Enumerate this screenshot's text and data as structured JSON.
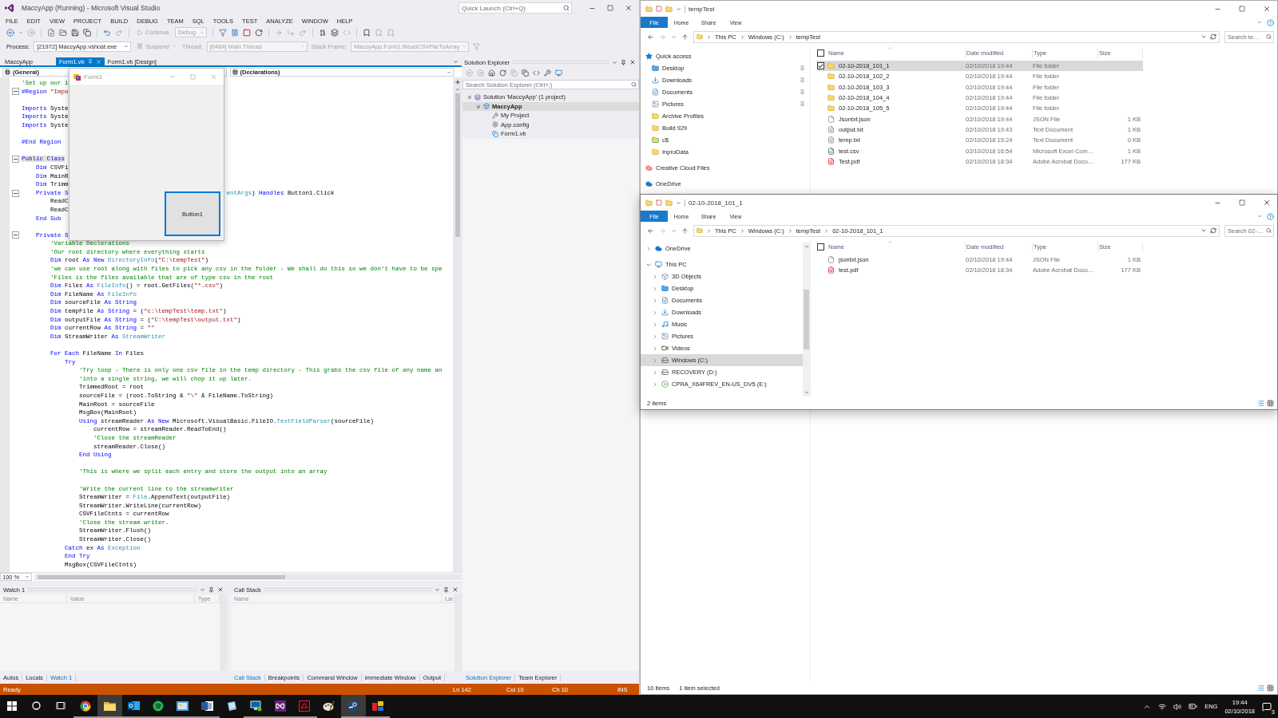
{
  "vs": {
    "title": "MaccyApp (Running) - Microsoft Visual Studio",
    "quick_launch": {
      "placeholder": "Quick Launch (Ctrl+Q)"
    },
    "menu": [
      "FILE",
      "EDIT",
      "VIEW",
      "PROJECT",
      "BUILD",
      "DEBUG",
      "TEAM",
      "SQL",
      "TOOLS",
      "TEST",
      "ANALYZE",
      "WINDOW",
      "HELP"
    ],
    "debug_toolbar": [
      {
        "kind": "button",
        "text": "Continue",
        "disabled": true
      },
      {
        "kind": "dropdown",
        "text": "Debug",
        "disabled": true
      }
    ],
    "process_toolbar": [
      {
        "kind": "label",
        "text": "Process:",
        "disabled": false
      },
      {
        "kind": "dropdown",
        "text": "[21972] MaccyApp.vshost.exe",
        "disabled": false
      },
      {
        "kind": "button",
        "text": "Suspend",
        "disabled": true
      },
      {
        "kind": "label",
        "text": "Thread:",
        "disabled": true
      },
      {
        "kind": "dropdown",
        "text": "[6484] Main Thread",
        "disabled": true
      },
      {
        "kind": "label",
        "text": "Stack Frame:",
        "disabled": true
      },
      {
        "kind": "dropdown",
        "text": "MaccyApp.Form1.ReadCSVFileToArray",
        "disabled": true
      }
    ],
    "project": "MaccyApp",
    "document_tabs": [
      {
        "label": "Form1.vb",
        "selected": true
      },
      {
        "label": "Form1.vb [Design]",
        "selected": false
      }
    ],
    "navigation": {
      "types": "(General)",
      "members": "(Declarations)"
    },
    "code": [
      {
        "kind": "code",
        "fold": false,
        "tokens": [
          {
            "kind": "comment",
            "text": "'Set up our i"
          }
        ]
      },
      {
        "kind": "code",
        "fold": true,
        "tokens": [
          {
            "kind": "keyword",
            "text": "#Region"
          },
          {
            "kind": "string",
            "text": " \"Impo"
          }
        ]
      },
      {
        "kind": "blank"
      },
      {
        "kind": "code",
        "fold": false,
        "tokens": [
          {
            "kind": "keyword",
            "text": "Imports"
          },
          {
            "kind": "plain",
            "text": " Syste"
          }
        ]
      },
      {
        "kind": "code",
        "fold": false,
        "tokens": [
          {
            "kind": "keyword",
            "text": "Imports"
          },
          {
            "kind": "plain",
            "text": " Syste"
          }
        ]
      },
      {
        "kind": "code",
        "fold": false,
        "tokens": [
          {
            "kind": "keyword",
            "text": "Imports"
          },
          {
            "kind": "plain",
            "text": " Syste"
          }
        ]
      },
      {
        "kind": "blank"
      },
      {
        "kind": "code",
        "fold": false,
        "tokens": [
          {
            "kind": "keyword",
            "text": "#End Region"
          }
        ]
      },
      {
        "kind": "blank"
      },
      {
        "kind": "code",
        "fold": true,
        "tokens": [
          {
            "kind": "match",
            "text": "Public Class"
          }
        ]
      },
      {
        "kind": "code",
        "fold": false,
        "tokens": [
          {
            "kind": "keyword",
            "text": "    Dim"
          },
          {
            "kind": "plain",
            "text": " CSVFi"
          }
        ]
      },
      {
        "kind": "code",
        "fold": false,
        "tokens": [
          {
            "kind": "keyword",
            "text": "    Dim"
          },
          {
            "kind": "plain",
            "text": " MainR"
          }
        ]
      },
      {
        "kind": "code",
        "fold": false,
        "tokens": [
          {
            "kind": "keyword",
            "text": "    Dim"
          },
          {
            "kind": "plain",
            "text": " Trimm"
          }
        ]
      },
      {
        "kind": "code",
        "fold": true,
        "tokens": [
          {
            "kind": "keyword",
            "text": "    Private S"
          }
        ],
        "tail": [
          {
            "kind": "type",
            "text": "entArgs"
          },
          {
            "kind": "plain",
            "text": ") "
          },
          {
            "kind": "keyword",
            "text": "Handles"
          },
          {
            "kind": "plain",
            "text": " Button1.Click"
          }
        ]
      },
      {
        "kind": "code",
        "fold": false,
        "tokens": [
          {
            "kind": "plain",
            "text": "        ReadC"
          }
        ]
      },
      {
        "kind": "code",
        "fold": false,
        "tokens": [
          {
            "kind": "plain",
            "text": "        ReadC"
          }
        ]
      },
      {
        "kind": "code",
        "fold": false,
        "tokens": [
          {
            "kind": "keyword",
            "text": "    End Sub"
          }
        ]
      },
      {
        "kind": "blank"
      },
      {
        "kind": "code",
        "fold": true,
        "tokens": [
          {
            "kind": "keyword",
            "text": "    Private S"
          }
        ]
      },
      {
        "kind": "code",
        "fold": false,
        "tokens": [
          {
            "kind": "comment",
            "text": "        'Variable Declerations"
          }
        ]
      },
      {
        "kind": "code",
        "fold": false,
        "tokens": [
          {
            "kind": "comment",
            "text": "        'Our root directory where everything starts"
          }
        ]
      },
      {
        "kind": "code",
        "fold": false,
        "tokens": [
          {
            "kind": "keyword",
            "text": "        Dim"
          },
          {
            "kind": "plain",
            "text": " root "
          },
          {
            "kind": "keyword",
            "text": "As New "
          },
          {
            "kind": "type",
            "text": "DirectoryInfo"
          },
          {
            "kind": "plain",
            "text": "("
          },
          {
            "kind": "string",
            "text": "\"C:\\tempTest\""
          },
          {
            "kind": "plain",
            "text": ")"
          }
        ]
      },
      {
        "kind": "code",
        "fold": false,
        "tokens": [
          {
            "kind": "comment",
            "text": "        'we can use root along with files to pick any csv in the folder - We shall do this so we don't have to be spe"
          }
        ]
      },
      {
        "kind": "code",
        "fold": false,
        "tokens": [
          {
            "kind": "comment",
            "text": "        'Files is the files available that are of type csv in the root"
          }
        ]
      },
      {
        "kind": "code",
        "fold": false,
        "tokens": [
          {
            "kind": "keyword",
            "text": "        Dim"
          },
          {
            "kind": "plain",
            "text": " Files "
          },
          {
            "kind": "keyword",
            "text": "As "
          },
          {
            "kind": "type",
            "text": "FileInfo"
          },
          {
            "kind": "plain",
            "text": "() = root.GetFiles("
          },
          {
            "kind": "string",
            "text": "\"*.csv\""
          },
          {
            "kind": "plain",
            "text": ")"
          }
        ]
      },
      {
        "kind": "code",
        "fold": false,
        "tokens": [
          {
            "kind": "keyword",
            "text": "        Dim"
          },
          {
            "kind": "plain",
            "text": " FileName "
          },
          {
            "kind": "keyword",
            "text": "As "
          },
          {
            "kind": "type",
            "text": "FileInfo"
          }
        ]
      },
      {
        "kind": "code",
        "fold": false,
        "tokens": [
          {
            "kind": "keyword",
            "text": "        Dim"
          },
          {
            "kind": "plain",
            "text": " sourceFile "
          },
          {
            "kind": "keyword",
            "text": "As String"
          }
        ]
      },
      {
        "kind": "code",
        "fold": false,
        "tokens": [
          {
            "kind": "keyword",
            "text": "        Dim"
          },
          {
            "kind": "plain",
            "text": " tempFile "
          },
          {
            "kind": "keyword",
            "text": "As String"
          },
          {
            "kind": "plain",
            "text": " = ("
          },
          {
            "kind": "string",
            "text": "\"c:\\tempTest\\temp.txt\""
          },
          {
            "kind": "plain",
            "text": ")"
          }
        ]
      },
      {
        "kind": "code",
        "fold": false,
        "tokens": [
          {
            "kind": "keyword",
            "text": "        Dim"
          },
          {
            "kind": "plain",
            "text": " outputFile "
          },
          {
            "kind": "keyword",
            "text": "As String"
          },
          {
            "kind": "plain",
            "text": " = ("
          },
          {
            "kind": "string",
            "text": "\"C:\\tempTest\\output.txt\""
          },
          {
            "kind": "plain",
            "text": ")"
          }
        ]
      },
      {
        "kind": "code",
        "fold": false,
        "tokens": [
          {
            "kind": "keyword",
            "text": "        Dim"
          },
          {
            "kind": "plain",
            "text": " currentRow "
          },
          {
            "kind": "keyword",
            "text": "As String"
          },
          {
            "kind": "plain",
            "text": " = "
          },
          {
            "kind": "string",
            "text": "\"\""
          }
        ]
      },
      {
        "kind": "code",
        "fold": false,
        "tokens": [
          {
            "kind": "keyword",
            "text": "        Dim"
          },
          {
            "kind": "plain",
            "text": " StreamWriter "
          },
          {
            "kind": "keyword",
            "text": "As "
          },
          {
            "kind": "type",
            "text": "StreamWriter"
          }
        ]
      },
      {
        "kind": "blank"
      },
      {
        "kind": "code",
        "fold": false,
        "tokens": [
          {
            "kind": "keyword",
            "text": "        For Each"
          },
          {
            "kind": "plain",
            "text": " FileName "
          },
          {
            "kind": "keyword",
            "text": "In"
          },
          {
            "kind": "plain",
            "text": " Files"
          }
        ]
      },
      {
        "kind": "code",
        "fold": false,
        "tokens": [
          {
            "kind": "keyword",
            "text": "            Try"
          }
        ]
      },
      {
        "kind": "code",
        "fold": false,
        "tokens": [
          {
            "kind": "comment",
            "text": "                'Try loop - There is only one csv file in the temp directory - This grabs the csv file of any name an"
          }
        ]
      },
      {
        "kind": "code",
        "fold": false,
        "tokens": [
          {
            "kind": "comment",
            "text": "                'into a single string, we will chop it up later."
          }
        ]
      },
      {
        "kind": "code",
        "fold": false,
        "tokens": [
          {
            "kind": "plain",
            "text": "                TrimmedRoot = root"
          }
        ]
      },
      {
        "kind": "code",
        "fold": false,
        "tokens": [
          {
            "kind": "plain",
            "text": "                sourceFile = (root.ToString & "
          },
          {
            "kind": "string",
            "text": "\"\\\""
          },
          {
            "kind": "plain",
            "text": " & FileName.ToString)"
          }
        ]
      },
      {
        "kind": "code",
        "fold": false,
        "tokens": [
          {
            "kind": "plain",
            "text": "                MainRoot = sourceFile"
          }
        ]
      },
      {
        "kind": "code",
        "fold": false,
        "tokens": [
          {
            "kind": "plain",
            "text": "                MsgBox(MainRoot)"
          }
        ]
      },
      {
        "kind": "code",
        "fold": false,
        "tokens": [
          {
            "kind": "keyword",
            "text": "                Using"
          },
          {
            "kind": "plain",
            "text": " streamReader "
          },
          {
            "kind": "keyword",
            "text": "As New"
          },
          {
            "kind": "plain",
            "text": " Microsoft.VisualBasic.FileIO."
          },
          {
            "kind": "type",
            "text": "TextFieldParser"
          },
          {
            "kind": "plain",
            "text": "(sourceFile)"
          }
        ]
      },
      {
        "kind": "code",
        "fold": false,
        "tokens": [
          {
            "kind": "plain",
            "text": "                    currentRow = streamReader.ReadToEnd()"
          }
        ]
      },
      {
        "kind": "code",
        "fold": false,
        "tokens": [
          {
            "kind": "comment",
            "text": "                    'Close the streamReader"
          }
        ]
      },
      {
        "kind": "code",
        "fold": false,
        "tokens": [
          {
            "kind": "plain",
            "text": "                    streamReader.Close()"
          }
        ]
      },
      {
        "kind": "code",
        "fold": false,
        "tokens": [
          {
            "kind": "keyword",
            "text": "                End Using"
          }
        ]
      },
      {
        "kind": "blank"
      },
      {
        "kind": "code",
        "fold": false,
        "tokens": [
          {
            "kind": "comment",
            "text": "                'This is where we split each entry and store the output into an array"
          }
        ]
      },
      {
        "kind": "blank"
      },
      {
        "kind": "code",
        "fold": false,
        "tokens": [
          {
            "kind": "comment",
            "text": "                'Write the current line to the streamwriter"
          }
        ]
      },
      {
        "kind": "code",
        "fold": false,
        "tokens": [
          {
            "kind": "plain",
            "text": "                StreamWriter = "
          },
          {
            "kind": "type",
            "text": "File"
          },
          {
            "kind": "plain",
            "text": ".AppendText(outputFile)"
          }
        ]
      },
      {
        "kind": "code",
        "fold": false,
        "tokens": [
          {
            "kind": "plain",
            "text": "                StreamWriter.WriteLine(currentRow)"
          }
        ]
      },
      {
        "kind": "code",
        "fold": false,
        "tokens": [
          {
            "kind": "plain",
            "text": "                CSVFileCtnts = currentRow"
          }
        ]
      },
      {
        "kind": "code",
        "fold": false,
        "tokens": [
          {
            "kind": "comment",
            "text": "                'Close the stream writer."
          }
        ]
      },
      {
        "kind": "code",
        "fold": false,
        "tokens": [
          {
            "kind": "plain",
            "text": "                StreamWriter.Flush()"
          }
        ]
      },
      {
        "kind": "code",
        "fold": false,
        "tokens": [
          {
            "kind": "plain",
            "text": "                StreamWriter.Close()"
          }
        ]
      },
      {
        "kind": "code",
        "fold": false,
        "tokens": [
          {
            "kind": "keyword",
            "text": "            Catch"
          },
          {
            "kind": "plain",
            "text": " ex "
          },
          {
            "kind": "keyword",
            "text": "As "
          },
          {
            "kind": "type",
            "text": "Exception"
          }
        ]
      },
      {
        "kind": "code",
        "fold": false,
        "tokens": [
          {
            "kind": "keyword",
            "text": "            End Try"
          }
        ]
      },
      {
        "kind": "code",
        "fold": false,
        "tokens": [
          {
            "kind": "plain",
            "text": "            MsgBox(CSVFileCtnts)"
          }
        ]
      }
    ],
    "zoom": "100 %",
    "watch": {
      "title": "Watch 1",
      "columns": [
        "Name",
        "Value",
        "Type"
      ]
    },
    "call_stack": {
      "title": "Call Stack",
      "columns": [
        "Name",
        "Lar"
      ]
    },
    "watch_tabs": [
      {
        "label": "Autos",
        "selected": false
      },
      {
        "label": "Locals",
        "selected": false
      },
      {
        "label": "Watch 1",
        "selected": true
      }
    ],
    "debug_tabs": [
      {
        "label": "Call Stack",
        "selected": true
      },
      {
        "label": "Breakpoints",
        "selected": false
      },
      {
        "label": "Command Window",
        "selected": false
      },
      {
        "label": "Immediate Window",
        "selected": false
      },
      {
        "label": "Output",
        "selected": false
      }
    ],
    "solution_explorer": {
      "title": "Solution Explorer",
      "search": {
        "placeholder": "Search Solution Explorer (Ctrl+;)"
      },
      "tree": [
        {
          "label": "Solution 'MaccyApp' (1 project)",
          "kind": "solution",
          "selected": false,
          "children": [
            {
              "label": "MaccyApp",
              "kind": "project",
              "selected": true,
              "children": [
                {
                  "label": "My Project",
                  "kind": "wrench",
                  "selected": false
                },
                {
                  "label": "App.config",
                  "kind": "config",
                  "selected": false
                },
                {
                  "label": "Form1.vb",
                  "kind": "form",
                  "selected": false
                }
              ]
            }
          ]
        }
      ],
      "tabs": [
        {
          "label": "Solution Explorer",
          "selected": true
        },
        {
          "label": "Team Explorer",
          "selected": false
        }
      ]
    },
    "status_bar": {
      "message": "Ready",
      "line": "Ln 142",
      "column": "Col 10",
      "char": "Ch 10",
      "mode": "INS"
    }
  },
  "form1": {
    "title": "Form1",
    "button": "Button1"
  },
  "explorers": [
    {
      "title": "tempTest",
      "ribbon_tabs": [
        {
          "label": "File",
          "kind": "file"
        },
        {
          "label": "Home",
          "kind": "tab"
        },
        {
          "label": "Share",
          "kind": "tab"
        },
        {
          "label": "View",
          "kind": "tab"
        }
      ],
      "path": [
        "This PC",
        "Windows (C:)",
        "tempTest"
      ],
      "search": {
        "placeholder": "Search te…"
      },
      "nav": [
        {
          "label": "Quick access",
          "kind": "star",
          "selected": false,
          "children": [
            {
              "label": "Desktop",
              "kind": "desktop",
              "pinned": true,
              "selected": false
            },
            {
              "label": "Downloads",
              "kind": "download",
              "pinned": true,
              "selected": false
            },
            {
              "label": "Documents",
              "kind": "documents",
              "pinned": true,
              "selected": false
            },
            {
              "label": "Pictures",
              "kind": "pictures",
              "pinned": true,
              "selected": false
            },
            {
              "label": "Archive Profiles",
              "kind": "folder",
              "pinned": false,
              "selected": false
            },
            {
              "label": "Build 929",
              "kind": "folder",
              "pinned": false,
              "selected": false
            },
            {
              "label": "c$",
              "kind": "share",
              "pinned": false,
              "selected": false
            },
            {
              "label": "InproData",
              "kind": "folder",
              "pinned": false,
              "selected": false
            }
          ]
        },
        {
          "label": "Creative Cloud Files",
          "kind": "creative",
          "selected": false
        },
        {
          "label": "OneDrive",
          "kind": "cloud",
          "selected": false
        }
      ],
      "all_selected": false,
      "columns": [
        "Name",
        "Date modified",
        "Type",
        "Size"
      ],
      "files": [
        {
          "name": "02-10-2018_101_1",
          "modified": "02/10/2018 19:44",
          "type": "File folder",
          "kind": "folder",
          "selected": true
        },
        {
          "name": "02-10-2018_102_2",
          "modified": "02/10/2018 19:44",
          "type": "File folder",
          "kind": "folder",
          "selected": false
        },
        {
          "name": "02-10-2018_103_3",
          "modified": "02/10/2018 19:44",
          "type": "File folder",
          "kind": "folder",
          "selected": false
        },
        {
          "name": "02-10-2018_104_4",
          "modified": "02/10/2018 19:44",
          "type": "File folder",
          "kind": "folder",
          "selected": false
        },
        {
          "name": "02-10-2018_105_5",
          "modified": "02/10/2018 19:44",
          "type": "File folder",
          "kind": "folder",
          "selected": false
        },
        {
          "name": "Jsontxt.json",
          "modified": "02/10/2018 19:44",
          "type": "JSON File",
          "size": "1 KB",
          "kind": "file",
          "selected": false
        },
        {
          "name": "output.txt",
          "modified": "02/10/2018 19:43",
          "type": "Text Document",
          "size": "1 KB",
          "kind": "text",
          "selected": false
        },
        {
          "name": "temp.txt",
          "modified": "02/10/2018 15:24",
          "type": "Text Document",
          "size": "0 KB",
          "kind": "text",
          "selected": false
        },
        {
          "name": "test.csv",
          "modified": "02/10/2018 16:54",
          "type": "Microsoft Excel Com…",
          "size": "1 KB",
          "kind": "excel",
          "selected": false
        },
        {
          "name": "Test.pdf",
          "modified": "02/10/2018 18:34",
          "type": "Adobe Acrobat Docu…",
          "size": "177 KB",
          "kind": "pdf",
          "selected": false
        }
      ],
      "status": [
        "10 items",
        "1 item selected"
      ]
    },
    {
      "title": "02-10-2018_101_1",
      "ribbon_tabs": [
        {
          "label": "File",
          "kind": "file"
        },
        {
          "label": "Home",
          "kind": "tab"
        },
        {
          "label": "Share",
          "kind": "tab"
        },
        {
          "label": "View",
          "kind": "tab"
        }
      ],
      "path": [
        "This PC",
        "Windows (C:)",
        "tempTest",
        "02-10-2018_101_1"
      ],
      "search": {
        "placeholder": "Search 02-…"
      },
      "nav": [
        {
          "label": "OneDrive",
          "kind": "cloud",
          "expanded": false,
          "selected": false
        },
        {
          "label": "This PC",
          "kind": "pc",
          "expanded": true,
          "selected": false,
          "children": [
            {
              "label": "3D Objects",
              "kind": "objects",
              "expanded": false,
              "selected": false
            },
            {
              "label": "Desktop",
              "kind": "desktop",
              "expanded": false,
              "selected": false
            },
            {
              "label": "Documents",
              "kind": "documents",
              "expanded": false,
              "selected": false
            },
            {
              "label": "Downloads",
              "kind": "download",
              "expanded": false,
              "selected": false
            },
            {
              "label": "Music",
              "kind": "music",
              "expanded": false,
              "selected": false
            },
            {
              "label": "Pictures",
              "kind": "pictures",
              "expanded": false,
              "selected": false
            },
            {
              "label": "Videos",
              "kind": "videos",
              "expanded": false,
              "selected": false
            },
            {
              "label": "Windows (C:)",
              "kind": "drive",
              "expanded": false,
              "selected": true
            },
            {
              "label": "RECOVERY (D:)",
              "kind": "drive",
              "expanded": false,
              "selected": false
            },
            {
              "label": "CPRA_X64FREV_EN-US_DV5 (E:)",
              "kind": "disc",
              "expanded": false,
              "selected": false
            }
          ]
        }
      ],
      "all_selected": false,
      "columns": [
        "Name",
        "Date modified",
        "Type",
        "Size"
      ],
      "files": [
        {
          "name": "jsontxt.json",
          "modified": "02/10/2018 19:44",
          "type": "JSON File",
          "size": "1 KB",
          "kind": "file",
          "selected": false
        },
        {
          "name": "test.pdf",
          "modified": "02/10/2018 18:34",
          "type": "Adobe Acrobat Docu…",
          "size": "177 KB",
          "kind": "pdf",
          "selected": false
        }
      ],
      "status": [
        "2 items"
      ]
    }
  ],
  "taskbar": {
    "apps": [
      {
        "kind": "browser",
        "active": false,
        "running": true
      },
      {
        "kind": "files",
        "active": true,
        "running": true
      },
      {
        "kind": "mail",
        "active": false,
        "running": true
      },
      {
        "kind": "music",
        "active": false,
        "running": true
      },
      {
        "kind": "photos",
        "active": false,
        "running": true
      },
      {
        "kind": "word",
        "active": false,
        "running": true
      },
      {
        "kind": "notes",
        "active": false,
        "running": false
      },
      {
        "kind": "remote",
        "active": false,
        "running": true
      },
      {
        "kind": "studio",
        "active": false,
        "running": true
      },
      {
        "kind": "pdf",
        "active": false,
        "running": true
      },
      {
        "kind": "paint",
        "active": false,
        "running": false
      },
      {
        "kind": "steam",
        "active": true,
        "running": true
      },
      {
        "kind": "tiles",
        "active": false,
        "running": true
      }
    ],
    "language": "ENG",
    "time": "19:44",
    "date": "02/10/2018",
    "notifications": "3"
  }
}
